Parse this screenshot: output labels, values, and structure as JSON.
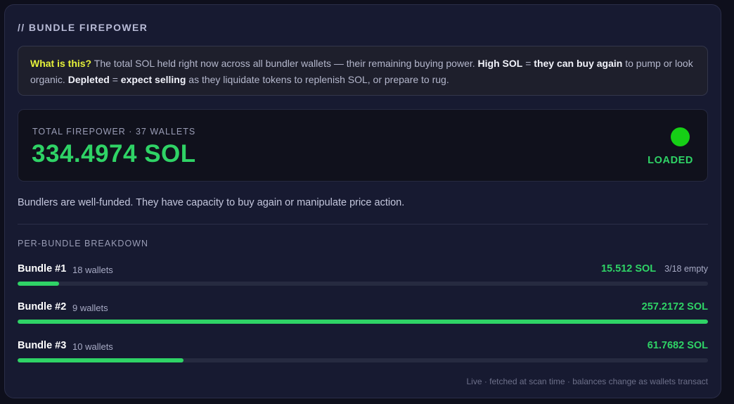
{
  "header": {
    "title": "// BUNDLE FIREPOWER"
  },
  "info": {
    "question": "What is this?",
    "text1": " The total SOL held right now across all bundler wallets — their remaining buying power. ",
    "high_sol": "High SOL",
    "eq1": " = ",
    "buy_again": "they can buy again",
    "text2": " to pump or look organic. ",
    "depleted": "Depleted",
    "eq2": " = ",
    "expect_selling": "expect selling",
    "text3": " as they liquidate tokens to replenish SOL, or prepare to rug."
  },
  "total": {
    "label": "TOTAL FIREPOWER · 37 WALLETS",
    "value": "334.4974 SOL",
    "status": "LOADED",
    "status_color": "#16cf16"
  },
  "summary": "Bundlers are well-funded. They have capacity to buy again or manipulate price action.",
  "breakdown": {
    "title": "PER-BUNDLE BREAKDOWN",
    "bundles": [
      {
        "name": "Bundle #1",
        "wallets": "18 wallets",
        "sol": "15.512 SOL",
        "empty": "3/18 empty",
        "fill": 0.06
      },
      {
        "name": "Bundle #2",
        "wallets": "9 wallets",
        "sol": "257.2172 SOL",
        "empty": "",
        "fill": 1.0
      },
      {
        "name": "Bundle #3",
        "wallets": "10 wallets",
        "sol": "61.7682 SOL",
        "empty": "",
        "fill": 0.24
      }
    ]
  },
  "footer": "Live · fetched at scan time · balances change as wallets transact",
  "colors": {
    "accent_green": "#2fd366",
    "highlight_yellow": "#e6f23a"
  }
}
